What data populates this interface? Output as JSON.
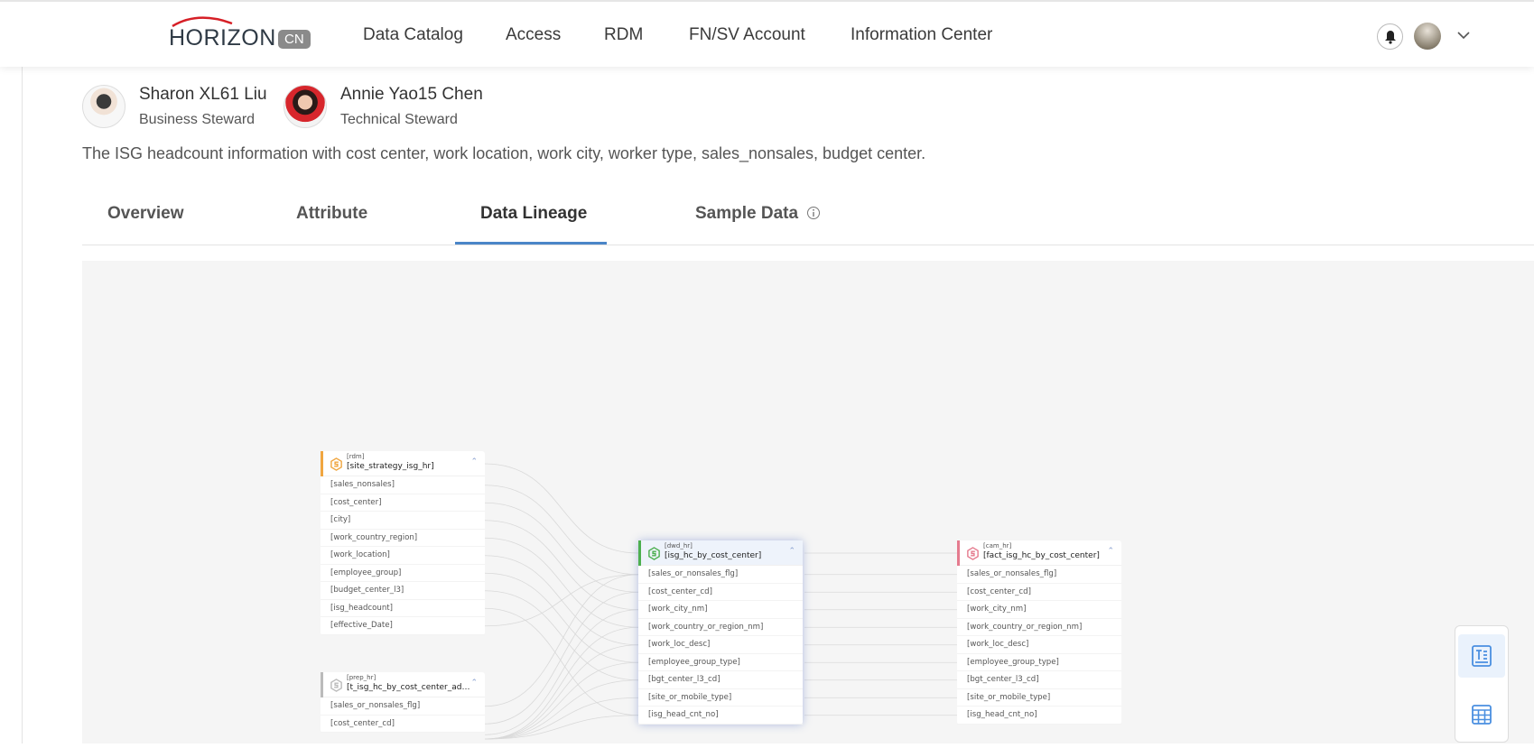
{
  "header": {
    "logo": "HORIZON",
    "logo_badge": "CN",
    "nav": [
      "Data Catalog",
      "Access",
      "RDM",
      "FN/SV Account",
      "Information Center"
    ],
    "icons": [
      "bell-icon",
      "user-avatar",
      "chevron-down-icon"
    ]
  },
  "stewards": [
    {
      "name": "Sharon XL61 Liu",
      "role": "Business Steward"
    },
    {
      "name": "Annie Yao15 Chen",
      "role": "Technical Steward"
    }
  ],
  "description": "The ISG headcount information with cost center, work location, work city, worker type, sales_nonsales, budget center.",
  "tabs": [
    {
      "label": "Overview"
    },
    {
      "label": "Attribute"
    },
    {
      "label": "Data Lineage",
      "active": true
    },
    {
      "label": "Sample Data",
      "icon": "info-icon"
    }
  ],
  "lineage": {
    "nodes": [
      {
        "schema": "[rdm]",
        "table": "[site_strategy_isg_hr]",
        "color": "#f0a640",
        "rows": [
          "[sales_nonsales]",
          "[cost_center]",
          "[city]",
          "[work_country_region]",
          "[work_location]",
          "[employee_group]",
          "[budget_center_l3]",
          "[isg_headcount]",
          "[effective_Date]"
        ]
      },
      {
        "schema": "[prep_hr]",
        "table": "[t_isg_hc_by_cost_center_adb_sy...",
        "color": "#bbbbbb",
        "rows": [
          "[sales_or_nonsales_flg]",
          "[cost_center_cd]"
        ]
      },
      {
        "schema": "[dwd_hr]",
        "table": "[isg_hc_by_cost_center]",
        "color": "#4caf50",
        "rows": [
          "[sales_or_nonsales_flg]",
          "[cost_center_cd]",
          "[work_city_nm]",
          "[work_country_or_region_nm]",
          "[work_loc_desc]",
          "[employee_group_type]",
          "[bgt_center_l3_cd]",
          "[site_or_mobile_type]",
          "[isg_head_cnt_no]"
        ]
      },
      {
        "schema": "[cam_hr]",
        "table": "[fact_isg_hc_by_cost_center]",
        "color": "#e57b8e",
        "rows": [
          "[sales_or_nonsales_flg]",
          "[cost_center_cd]",
          "[work_city_nm]",
          "[work_country_or_region_nm]",
          "[work_loc_desc]",
          "[employee_group_type]",
          "[bgt_center_l3_cd]",
          "[site_or_mobile_type]",
          "[isg_head_cnt_no]"
        ]
      }
    ],
    "toolbar": [
      "table-detail-icon",
      "grid-table-icon"
    ]
  },
  "colors": {
    "accent": "#4a86c8",
    "canvas": "#f5f5f5"
  }
}
